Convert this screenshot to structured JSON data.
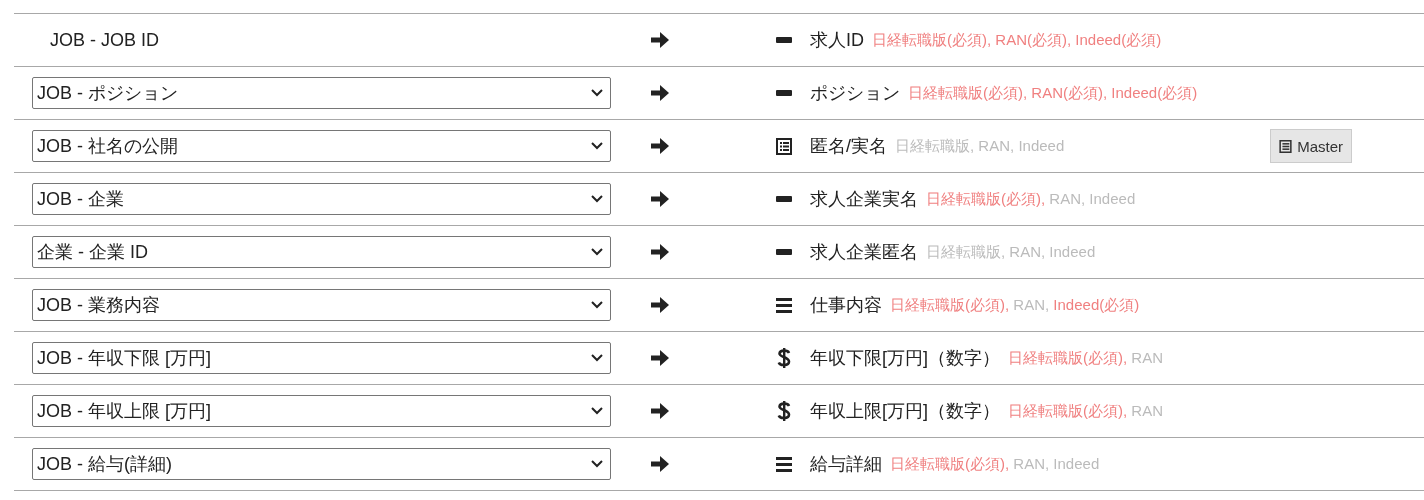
{
  "separator": ", ",
  "rows": [
    {
      "source": {
        "kind": "text",
        "text": "JOB - JOB ID"
      },
      "kind": "text",
      "label": "求人ID",
      "targets": [
        {
          "name": "日経転職版(必須)",
          "required": true
        },
        {
          "name": "RAN(必須)",
          "required": true
        },
        {
          "name": "Indeed(必須)",
          "required": true
        }
      ]
    },
    {
      "source": {
        "kind": "select",
        "text": "JOB - ポジション"
      },
      "kind": "text",
      "label": "ポジション",
      "targets": [
        {
          "name": "日経転職版(必須)",
          "required": true
        },
        {
          "name": "RAN(必須)",
          "required": true
        },
        {
          "name": "Indeed(必須)",
          "required": true
        }
      ]
    },
    {
      "source": {
        "kind": "select",
        "text": "JOB - 社名の公開"
      },
      "kind": "choice",
      "label": "匿名/実名",
      "targets": [
        {
          "name": "日経転職版",
          "required": false
        },
        {
          "name": "RAN",
          "required": false
        },
        {
          "name": "Indeed",
          "required": false
        }
      ],
      "button": "Master"
    },
    {
      "source": {
        "kind": "select",
        "text": "JOB - 企業"
      },
      "kind": "text",
      "label": "求人企業実名",
      "targets": [
        {
          "name": "日経転職版(必須)",
          "required": true
        },
        {
          "name": "RAN",
          "required": false
        },
        {
          "name": "Indeed",
          "required": false
        }
      ]
    },
    {
      "source": {
        "kind": "select",
        "text": "企業 - 企業 ID"
      },
      "kind": "text",
      "label": "求人企業匿名",
      "targets": [
        {
          "name": "日経転職版",
          "required": false
        },
        {
          "name": "RAN",
          "required": false
        },
        {
          "name": "Indeed",
          "required": false
        }
      ]
    },
    {
      "source": {
        "kind": "select",
        "text": "JOB - 業務内容"
      },
      "kind": "textarea",
      "label": "仕事内容",
      "targets": [
        {
          "name": "日経転職版(必須)",
          "required": true
        },
        {
          "name": "RAN",
          "required": false
        },
        {
          "name": "Indeed(必須)",
          "required": true
        }
      ]
    },
    {
      "source": {
        "kind": "select",
        "text": "JOB - 年収下限 [万円]"
      },
      "kind": "number",
      "label": "年収下限[万円]（数字）",
      "targets": [
        {
          "name": "日経転職版(必須)",
          "required": true
        },
        {
          "name": "RAN",
          "required": false
        }
      ]
    },
    {
      "source": {
        "kind": "select",
        "text": "JOB - 年収上限 [万円]"
      },
      "kind": "number",
      "label": "年収上限[万円]（数字）",
      "targets": [
        {
          "name": "日経転職版(必須)",
          "required": true
        },
        {
          "name": "RAN",
          "required": false
        }
      ]
    },
    {
      "source": {
        "kind": "select",
        "text": "JOB - 給与(詳細)"
      },
      "kind": "textarea",
      "label": "給与詳細",
      "targets": [
        {
          "name": "日経転職版(必須)",
          "required": true
        },
        {
          "name": "RAN",
          "required": false
        },
        {
          "name": "Indeed",
          "required": false
        }
      ]
    }
  ]
}
